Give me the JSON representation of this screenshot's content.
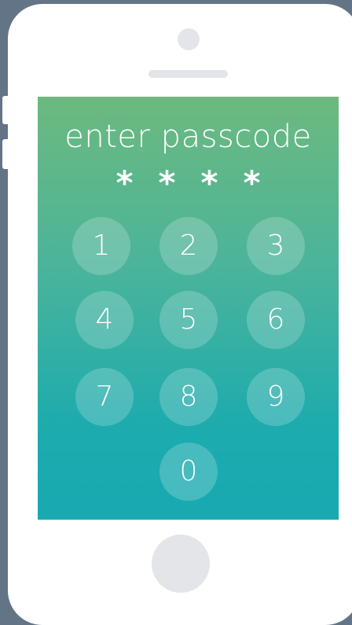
{
  "screen": {
    "title": "enter passcode",
    "passcode_mask": [
      "*",
      "*",
      "*",
      "*"
    ]
  },
  "keypad": {
    "keys": [
      "1",
      "2",
      "3",
      "4",
      "5",
      "6",
      "7",
      "8",
      "9",
      "0"
    ]
  },
  "colors": {
    "background": "#647487",
    "device": "#ffffff",
    "gradient_top": "#6db97f",
    "gradient_bottom": "#17aab0",
    "key_fill": "rgba(255,255,255,0.2)"
  }
}
